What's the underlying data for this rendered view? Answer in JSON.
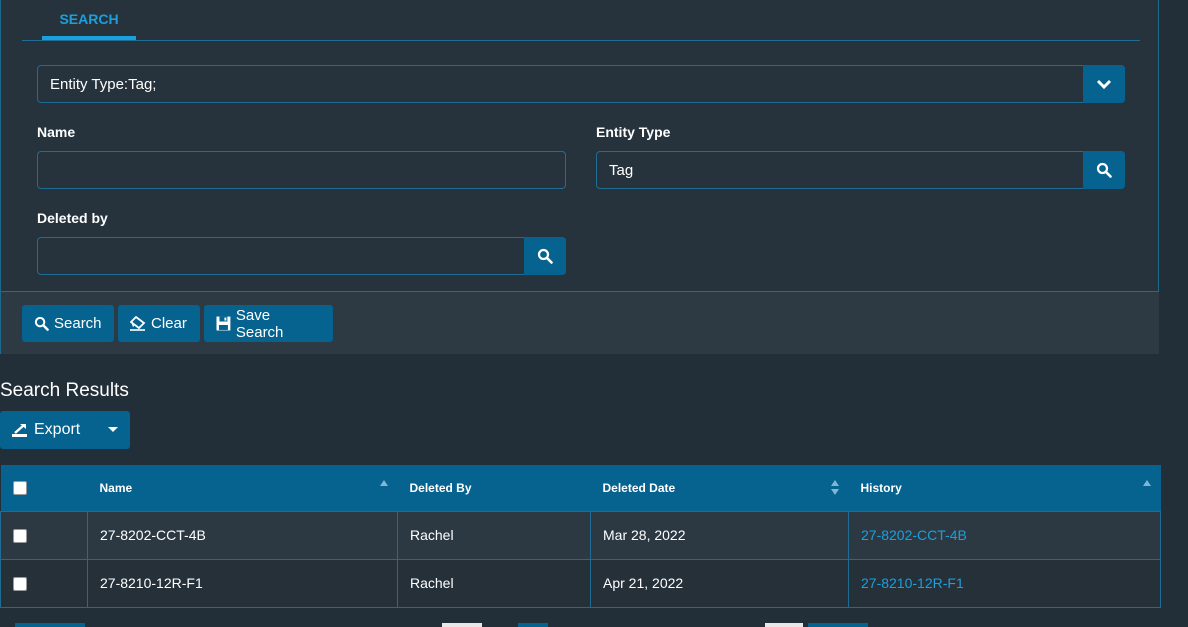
{
  "tabs": [
    {
      "label": "SEARCH",
      "active": true
    }
  ],
  "filter": {
    "value": "Entity Type:Tag;"
  },
  "fields": {
    "name": {
      "label": "Name",
      "value": ""
    },
    "entity_type": {
      "label": "Entity Type",
      "value": "Tag"
    },
    "deleted_by": {
      "label": "Deleted by",
      "value": ""
    }
  },
  "actions": {
    "search": "Search",
    "clear": "Clear",
    "save_search": "Save Search"
  },
  "results": {
    "title": "Search Results",
    "export_label": "Export",
    "columns": [
      "Name",
      "Deleted By",
      "Deleted Date",
      "History"
    ],
    "rows": [
      {
        "name": "27-8202-CCT-4B",
        "deleted_by": "Rachel",
        "deleted_date": "Mar 28, 2022",
        "history": "27-8202-CCT-4B"
      },
      {
        "name": "27-8210-12R-F1",
        "deleted_by": "Rachel",
        "deleted_date": "Apr 21, 2022",
        "history": "27-8210-12R-F1"
      }
    ]
  },
  "colors": {
    "accent": "#06628f",
    "link": "#1b9fdd",
    "background": "#232f38"
  }
}
